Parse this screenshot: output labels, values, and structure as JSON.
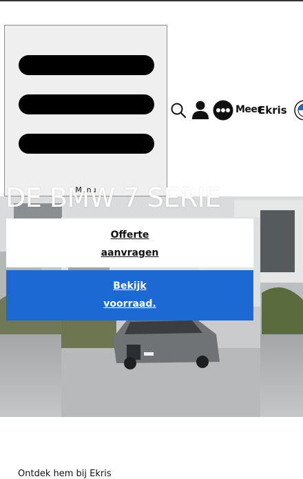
{
  "header": {
    "menu_label": "Menu",
    "more_label": "Meer",
    "dealer_label": "Ekris",
    "icons": [
      "search-icon",
      "user-icon",
      "more-icon",
      "bmw-logo-icon"
    ]
  },
  "hero": {
    "title": "DE BMW 7 SERIE",
    "cta_quote_line1": "Offerte",
    "cta_quote_line2": "aanvragen",
    "cta_stock_line1": "Bekijk",
    "cta_stock_line2": "voorraad."
  },
  "colors": {
    "accent_blue": "#1c69d4",
    "text": "#111111",
    "menu_bg": "#efefef"
  },
  "section": {
    "discover_text": "Ontdek hem bij Ekris"
  }
}
